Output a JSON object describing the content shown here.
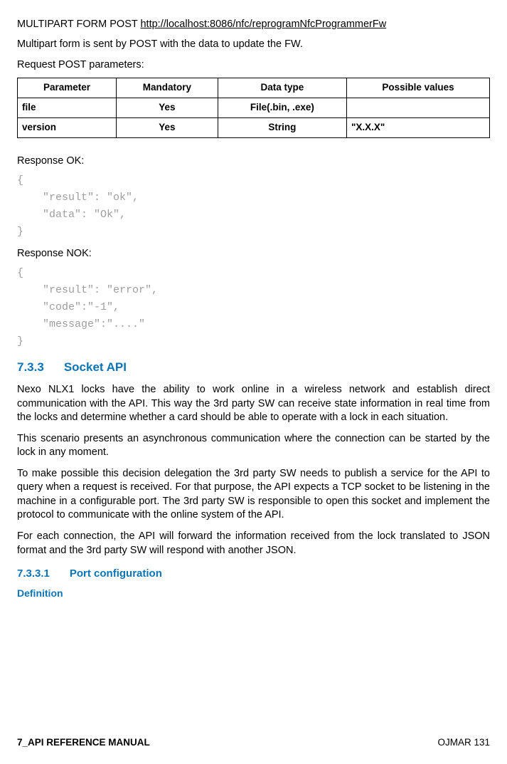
{
  "request": {
    "method_prefix": "MULTIPART FORM POST ",
    "url": "http://localhost:8086/nfc/reprogramNfcProgrammerFw",
    "description": "Multipart form is sent by POST with the data to update the FW.",
    "params_label": "Request POST parameters:"
  },
  "table": {
    "headers": {
      "parameter": "Parameter",
      "mandatory": "Mandatory",
      "datatype": "Data type",
      "possible": "Possible values"
    },
    "rows": [
      {
        "parameter": "file",
        "mandatory": "Yes",
        "datatype": "File(.bin, .exe)",
        "possible": ""
      },
      {
        "parameter": "version",
        "mandatory": "Yes",
        "datatype": "String",
        "possible": "\"X.X.X\""
      }
    ]
  },
  "responses": {
    "ok_label": "Response OK:",
    "ok_code": "{\n    \"result\": \"ok\",\n    \"data\": \"Ok\",\n}",
    "nok_label": "Response NOK:",
    "nok_code": "{\n    \"result\": \"error\",\n    \"code\":\"-1\",\n    \"message\":\"....\"\n}"
  },
  "section": {
    "num": "7.3.3",
    "title": "Socket API",
    "p1": "Nexo NLX1 locks have the ability to work online in a wireless network and establish direct communication with the API. This way the 3rd party SW can receive state information in real time from the locks and determine whether a card should be able to operate with a lock in each situation.",
    "p2": "This scenario presents an asynchronous communication where the connection can be started by the lock in any moment.",
    "p3": "To make possible this decision delegation the 3rd party SW needs to publish a service for the API to query when a request is received. For that purpose, the API expects a TCP socket to be listening in the machine in a configurable port. The 3rd party SW is responsible to open this socket and implement the protocol to communicate with the online system of the API.",
    "p4": "For each connection, the API will forward the information received from the lock translated to JSON format and the 3rd party SW will respond with another JSON."
  },
  "subsection": {
    "num": "7.3.3.1",
    "title": "Port configuration",
    "definition_label": "Definition"
  },
  "footer": {
    "left": "7_API REFERENCE MANUAL",
    "right": "OJMAR 131"
  }
}
